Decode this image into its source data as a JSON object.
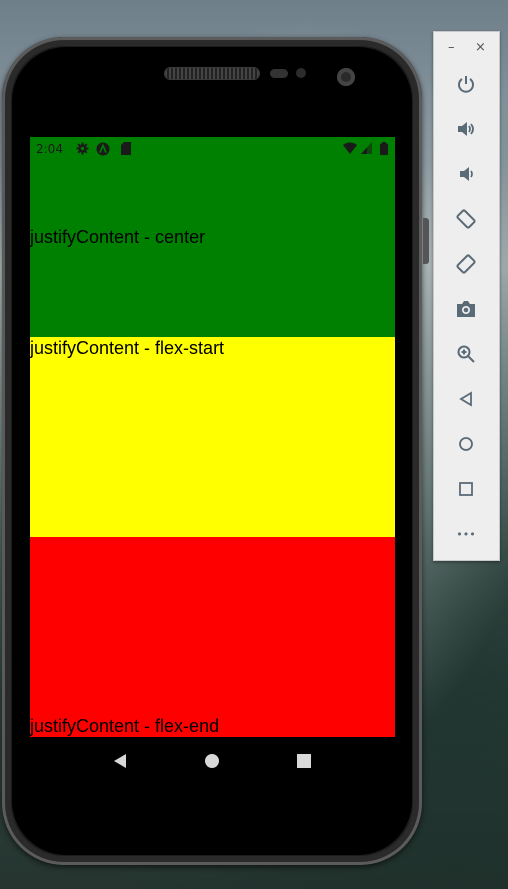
{
  "status_bar": {
    "time": "2:04"
  },
  "sections": {
    "center": {
      "label": "justifyContent - center",
      "color": "#008000"
    },
    "flex_start": {
      "label": "justifyContent - flex-start",
      "color": "#ffff00"
    },
    "flex_end": {
      "label": "justifyContent - flex-end",
      "color": "#ff0000"
    }
  },
  "nav_bar": {
    "buttons": [
      "back-icon",
      "home-icon",
      "recents-icon"
    ]
  },
  "emulator_toolbar": {
    "window_controls": {
      "minimize": "–",
      "close": "×"
    },
    "buttons": [
      "power-icon",
      "volume-up-icon",
      "volume-down-icon",
      "rotate-left-icon",
      "rotate-right-icon",
      "camera-icon",
      "zoom-icon",
      "back-icon",
      "home-icon",
      "overview-icon",
      "more-icon"
    ],
    "more_label": "•••"
  }
}
